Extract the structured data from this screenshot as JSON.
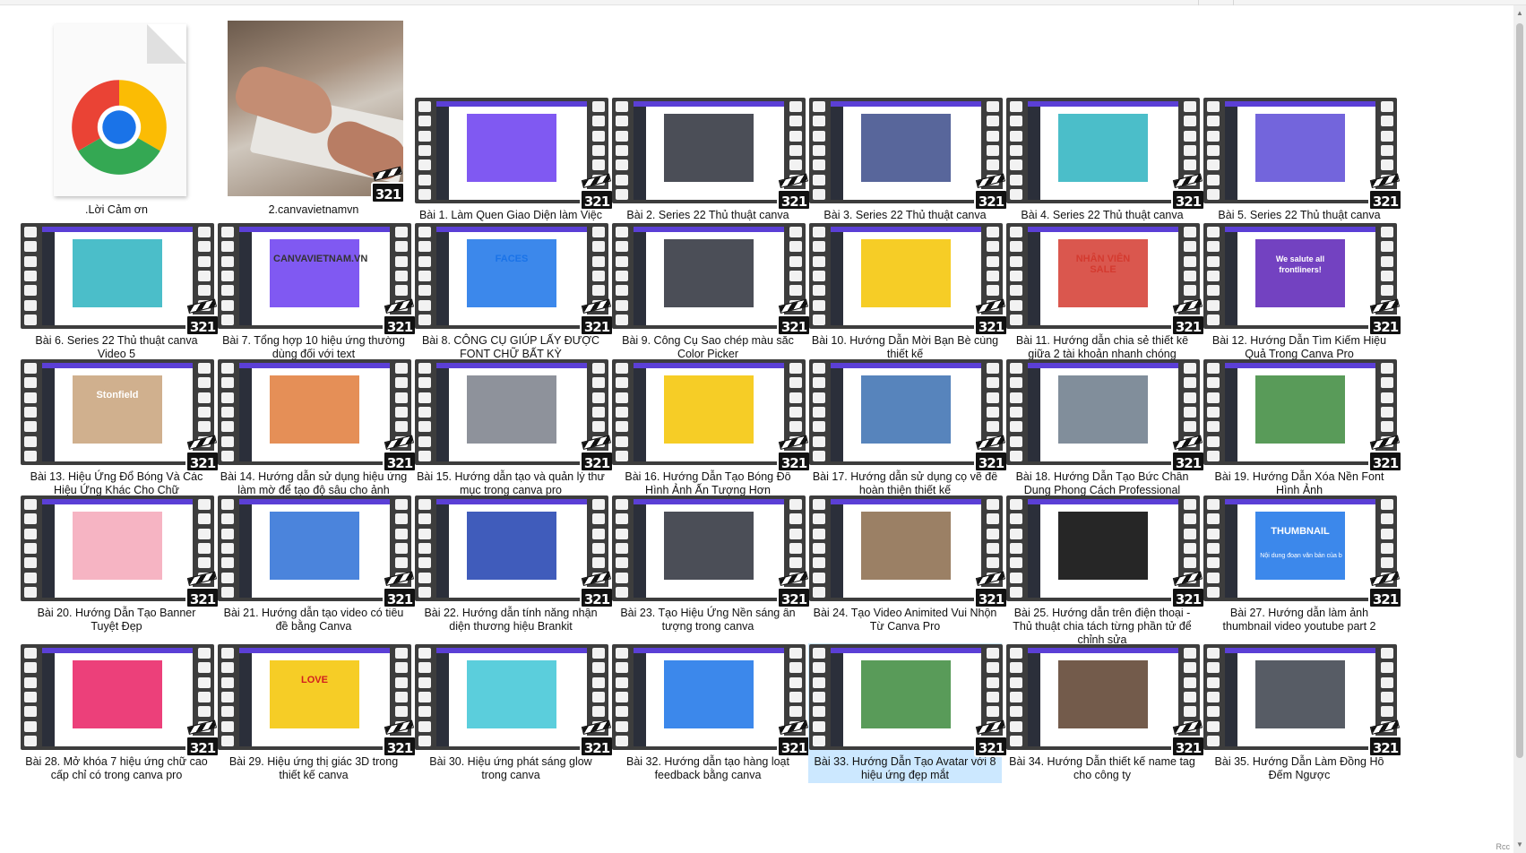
{
  "files": [
    {
      "label": ".Lời Cảm ơn",
      "kind": "chrome-doc",
      "icon": "chrome-icon"
    },
    {
      "label": "2.canvavietnamvn",
      "kind": "photo",
      "icon": "video-photo-thumbnail"
    },
    {
      "label": "Bài 1. Làm Quen Giao Diện làm Việc Canva",
      "kind": "video",
      "theme": "#6a3cf0",
      "badge": "321"
    },
    {
      "label": "Bài 2. Series 22 Thủ thuật canva Video 1",
      "kind": "video",
      "theme": "#2b2f3a",
      "badge": "321"
    },
    {
      "label": "Bài 3. Series 22 Thủ thuật canva Video  2",
      "kind": "video",
      "theme": "#3b4b8a",
      "badge": "321"
    },
    {
      "label": "Bài 4. Series 22 Thủ thuật canva Video 3",
      "kind": "video",
      "theme": "#2bb3c0",
      "badge": "321"
    },
    {
      "label": "Bài 5. Series 22 Thủ thuật canva Video 4",
      "kind": "video",
      "theme": "#5a4ad6",
      "badge": "321"
    },
    {
      "label": "Bài 6. Series 22 Thủ thuật canva Video  5",
      "kind": "video",
      "theme": "#2bb3c0",
      "badge": "321"
    },
    {
      "label": "Bài 7. Tổng hợp 10  hiệu ứng thường dùng đối với text",
      "kind": "video",
      "theme": "#6a3cf0",
      "badge": "321"
    },
    {
      "label": "Bài 8. CÔNG CỤ GIÚP LẤY ĐƯỢC FONT CHỮ BẤT KỲ",
      "kind": "video",
      "theme": "#1a73e8",
      "badge": "321"
    },
    {
      "label": "Bài 9. Công Cụ Sao chép màu sắc Color Picker",
      "kind": "video",
      "theme": "#2b2f3a",
      "badge": "321"
    },
    {
      "label": "Bài 10. Hướng Dẫn Mời Bạn Bè cùng thiết kế",
      "kind": "video",
      "theme": "#f5c400",
      "badge": "321"
    },
    {
      "label": "Bài 11. Hướng dẫn chia sẻ thiết kế giữa 2 tài khoản nhanh chóng",
      "kind": "video",
      "theme": "#d43a2f",
      "badge": "321"
    },
    {
      "label": "Bài 12. Hướng Dẫn Tìm Kiếm Hiệu Quả Trong Canva Pro",
      "kind": "video",
      "theme": "#5b21b6",
      "badge": "321"
    },
    {
      "label": "Bài 13. Hiệu Ứng Đổ Bóng Và Các Hiệu Ứng Khác Cho Chữ",
      "kind": "video",
      "theme": "#c8a27a",
      "badge": "321"
    },
    {
      "label": "Bài 14. Hướng dẫn sử dụng hiệu ứng làm mờ để tạo độ sâu cho ảnh",
      "kind": "video",
      "theme": "#e07b39",
      "badge": "321"
    },
    {
      "label": "Bài 15. Hướng dẫn tạo và quản lý thư mục trong canva pro",
      "kind": "video",
      "theme": "#7a7f8a",
      "badge": "321"
    },
    {
      "label": "Bài 16. Hướng Dẫn Tạo Bóng Đổ Hình Ảnh Ấn Tượng Hơn",
      "kind": "video",
      "theme": "#f5c400",
      "badge": "321"
    },
    {
      "label": "Bài 17. Hướng dẫn sử dụng cọ vẽ để hoàn thiện thiết kế",
      "kind": "video",
      "theme": "#3a6fb0",
      "badge": "321"
    },
    {
      "label": "Bài 18. Hướng Dẫn Tạo Bức Chân Dung Phong Cách Professional",
      "kind": "video",
      "theme": "#6b7a8a",
      "badge": "321"
    },
    {
      "label": "Bài 19. Hướng Dẫn Xóa Nền Font Hình Ảnh",
      "kind": "video",
      "theme": "#3c8a3c",
      "badge": "321"
    },
    {
      "label": "Bài 20. Hướng Dẫn Tạo Banner Tuyệt Đẹp",
      "kind": "video",
      "theme": "#f4a7b9",
      "badge": "321"
    },
    {
      "label": "Bài 21. Hướng dẫn tạo video có tiêu đề bằng Canva",
      "kind": "video",
      "theme": "#2b6fd6",
      "badge": "321"
    },
    {
      "label": "Bài 22. Hướng dẫn tính năng nhận diện thương hiệu Brankit",
      "kind": "video",
      "theme": "#1e40af",
      "badge": "321"
    },
    {
      "label": "Bài 23. Tạo Hiệu Ứng Nền sáng ấn tượng trong canva",
      "kind": "video",
      "theme": "#2b2f3a",
      "badge": "321"
    },
    {
      "label": "Bài 24. Tạo Video Animited Vui Nhộn Từ Canva Pro",
      "kind": "video",
      "theme": "#8a6a4a",
      "badge": "321"
    },
    {
      "label": "Bài 25. Hướng dẫn trên điện thoại - Thủ thuật chia tách từng phần tử để chỉnh sửa",
      "kind": "video",
      "theme": "#000000",
      "badge": "321"
    },
    {
      "label": "Bài 27. Hướng dẫn làm ảnh thumbnail video youtube part 2",
      "kind": "video",
      "theme": "#1a73e8",
      "badge": "321"
    },
    {
      "label": "Bài 28. Mở khóa 7 hiệu ứng chữ cao cấp chỉ có trong canva pro",
      "kind": "video",
      "theme": "#e91e63",
      "badge": "321"
    },
    {
      "label": "Bài 29. Hiệu ứng thị giác 3D trong thiết kế canva",
      "kind": "video",
      "theme": "#f5c400",
      "badge": "321"
    },
    {
      "label": "Bài 30. Hiệu ứng phát sáng glow trong canva",
      "kind": "video",
      "theme": "#3ec6d6",
      "badge": "321"
    },
    {
      "label": "Bài 32. Hướng dẫn tạo hàng loạt feedback bằng canva",
      "kind": "video",
      "theme": "#1a73e8",
      "badge": "321"
    },
    {
      "label": "Bài 33. Hướng Dẫn Tạo Avatar với 8 hiệu ứng đẹp mắt",
      "kind": "video",
      "theme": "#3c8a3c",
      "badge": "321",
      "selected": true
    },
    {
      "label": "Bài 34. Hướng Dẫn thiết kế name tag cho công ty",
      "kind": "video",
      "theme": "#5a3e2b",
      "badge": "321"
    },
    {
      "label": "Bài 35. Hướng Dẫn Làm Đồng Hồ Đếm Ngược",
      "kind": "video",
      "theme": "#3a3f4a",
      "badge": "321"
    }
  ],
  "thumb_texts": {
    "bai12": "We salute all frontliners!",
    "bai27": "THUMBNAIL",
    "bai27_sub": "Nội dung đoạn văn bản của b",
    "bai29": "LOVE",
    "bai8": "FACES",
    "bai7": "CANVAVIETNAM.VN",
    "bai11": "NHÂN VIÊN SALE",
    "bai13": "Stonfield"
  },
  "status": "Rcc"
}
